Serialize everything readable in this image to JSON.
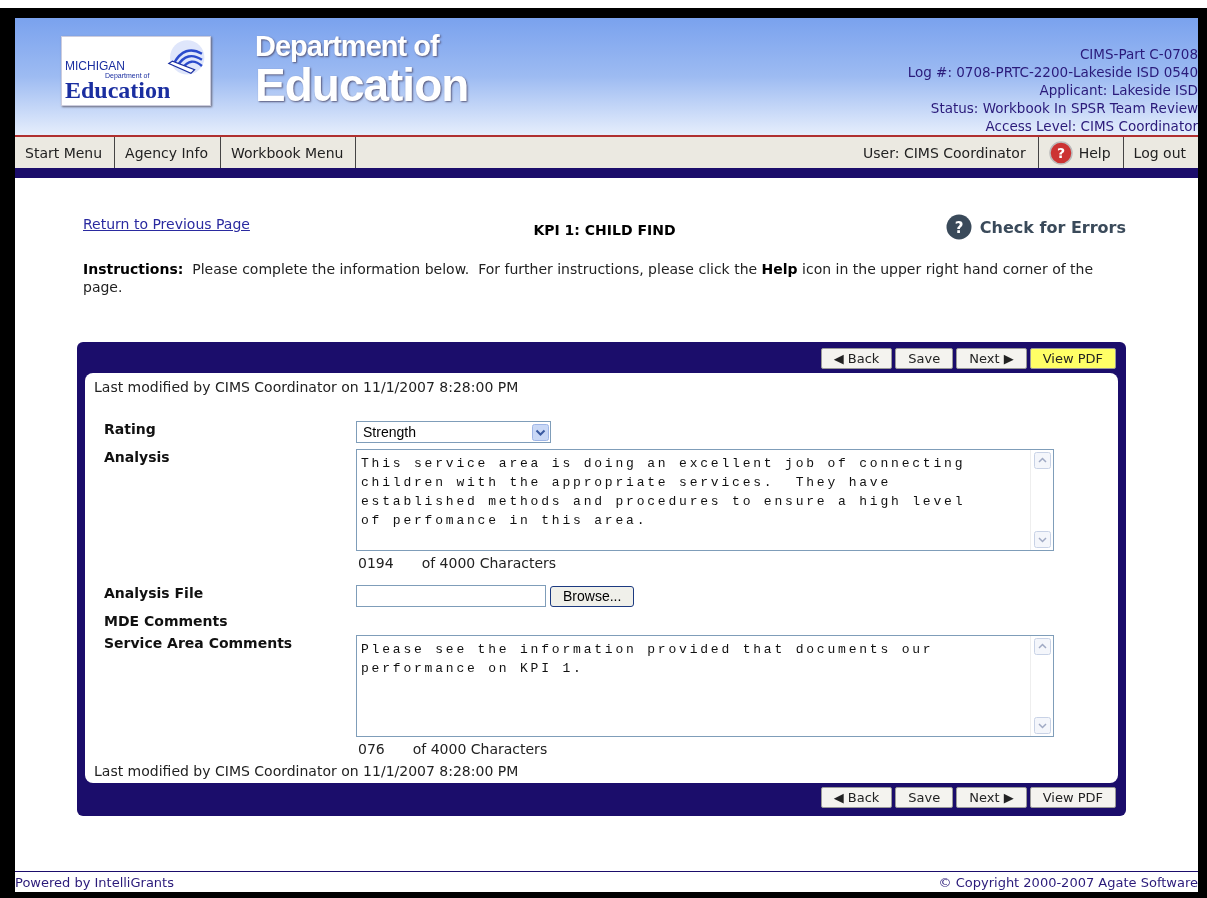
{
  "logo": {
    "state": "MICHIGAN",
    "department": "Department of",
    "name": "Education"
  },
  "header": {
    "title_line1": "Department of",
    "title_line2": "Education",
    "info": [
      "CIMS-Part C-0708",
      "Log #: 0708-PRTC-2200-Lakeside ISD 0540",
      "Applicant: Lakeside ISD",
      "Status: Workbook In SPSR Team Review",
      "Access Level: CIMS Coordinator"
    ]
  },
  "nav": {
    "left": [
      "Start Menu",
      "Agency Info",
      "Workbook Menu"
    ],
    "user": "User: CIMS Coordinator",
    "help_glyph": "?",
    "help": "Help",
    "logout": "Log out"
  },
  "page": {
    "back_link": "Return to Previous Page",
    "title": "KPI 1: CHILD FIND",
    "check_glyph": "?",
    "check_errors": "Check for Errors",
    "instructions": "**Instructions:**  Please complete the information below.  For further instructions, please click the **Help** icon in the upper right hand corner of the page."
  },
  "toolbar_top": [
    {
      "label": "◀ Back",
      "highlighted": false
    },
    {
      "label": "Save",
      "highlighted": false
    },
    {
      "label": "Next ▶",
      "highlighted": false
    },
    {
      "label": "View PDF",
      "highlighted": true
    }
  ],
  "modified_top": "Last modified by CIMS Coordinator on 11/1/2007 8:28:00 PM",
  "fields": [
    {
      "kind": "select",
      "label": "Rating",
      "value": "Strength"
    },
    {
      "kind": "textarea",
      "label": "Analysis",
      "value": "This service area is doing an excellent job of connecting children with the appropriate services.  They have established methods and procedures to ensure a high level of perfomance in this area.",
      "count": "0194",
      "limit": "of 4000 Characters"
    },
    {
      "kind": "file",
      "label": "Analysis File",
      "button": "Browse..."
    },
    {
      "kind": "label",
      "label": "MDE Comments"
    },
    {
      "kind": "textarea",
      "label": "Service Area Comments",
      "value": "Please see the information provided that documents our performance on KPI 1.",
      "count": "076",
      "limit": "of 4000 Characters"
    }
  ],
  "modified_bottom": "Last modified by CIMS Coordinator on 11/1/2007 8:28:00 PM",
  "toolbar_bottom": [
    {
      "label": "◀ Back",
      "highlighted": false
    },
    {
      "label": "Save",
      "highlighted": false
    },
    {
      "label": "Next ▶",
      "highlighted": false
    },
    {
      "label": "View PDF",
      "highlighted": false
    }
  ],
  "footer": {
    "left": "Powered by IntelliGrants",
    "right": "© Copyright 2000-2007 Agate Software"
  }
}
